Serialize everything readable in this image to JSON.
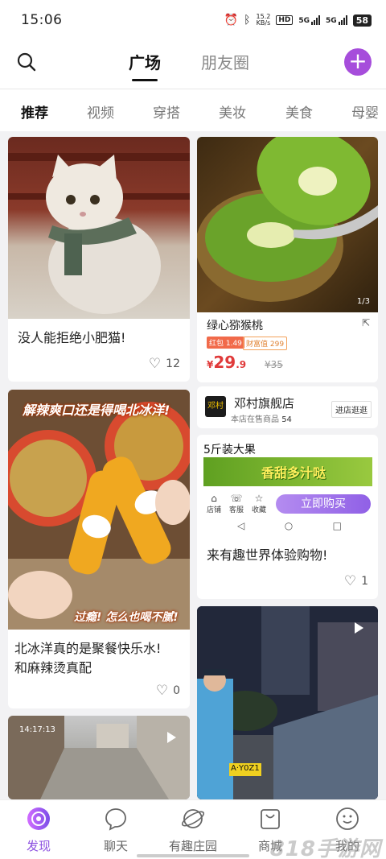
{
  "status": {
    "time": "15:06",
    "speed_value": "15.2",
    "speed_unit": "KB/s",
    "hd_label": "HD",
    "net1": "5G",
    "net2": "5G",
    "battery": "58"
  },
  "header": {
    "tabs": [
      "广场",
      "朋友圈"
    ],
    "active_tab": "广场",
    "add_label": "+"
  },
  "categories": [
    "推荐",
    "视频",
    "穿搭",
    "美妆",
    "美食",
    "母婴"
  ],
  "feed": {
    "cat_post": {
      "title": "没人能拒绝小肥猫!",
      "likes": "12"
    },
    "product": {
      "image_index": "1/3",
      "title": "绿心猕猴桃",
      "tag_red": "红包 1.49",
      "tag_coin": "财富值 299",
      "price_symbol": "¥",
      "price_int": "29",
      "price_dec": ".9",
      "old_price": "¥35"
    },
    "shop": {
      "name": "邓村旗舰店",
      "logo_text": "邓村",
      "count_label": "本店在售商品",
      "count": "54",
      "visit_label": "进店逛逛"
    },
    "drink_post": {
      "overlay_top": "解辣爽口还是得喝北冰洋!",
      "overlay_bottom": "过瘾! 怎么也喝不腻!",
      "title_line1": "北冰洋真的是聚餐快乐水!",
      "title_line2": "和麻辣烫真配",
      "likes": "0"
    },
    "ad_post": {
      "header": "5斤装大果",
      "banner": "香甜多汁哒",
      "icons": [
        "店铺",
        "客服",
        "收藏"
      ],
      "buy_label": "立即购买",
      "title": "来有趣世界体验购物!",
      "likes": "1"
    },
    "street_post": {
      "timestamp": "14:17:13"
    },
    "police_post": {
      "plate": "A·Y0Z1"
    }
  },
  "bottom_nav": {
    "items": [
      "发现",
      "聊天",
      "有趣庄园",
      "商城",
      "我的"
    ],
    "active": "发现"
  },
  "watermark": "818手游网",
  "colors": {
    "accent": "#a64ddb",
    "price_red": "#e03a3a",
    "active_nav": "#8c4fe0"
  }
}
